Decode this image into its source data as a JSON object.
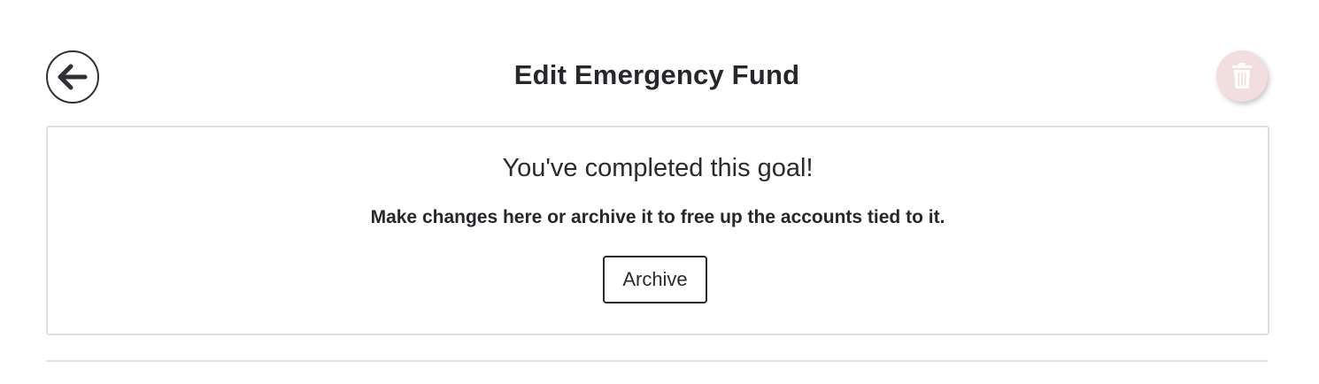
{
  "header": {
    "title": "Edit Emergency Fund",
    "back_icon": "arrow-left-icon",
    "delete_icon": "trash-icon"
  },
  "completion_card": {
    "title": "You've completed this goal!",
    "message": "Make changes here or archive it to free up the accounts tied to it.",
    "archive_label": "Archive"
  },
  "colors": {
    "text": "#26272b",
    "delete_bg": "#f2dede",
    "card_border": "#dedede"
  }
}
